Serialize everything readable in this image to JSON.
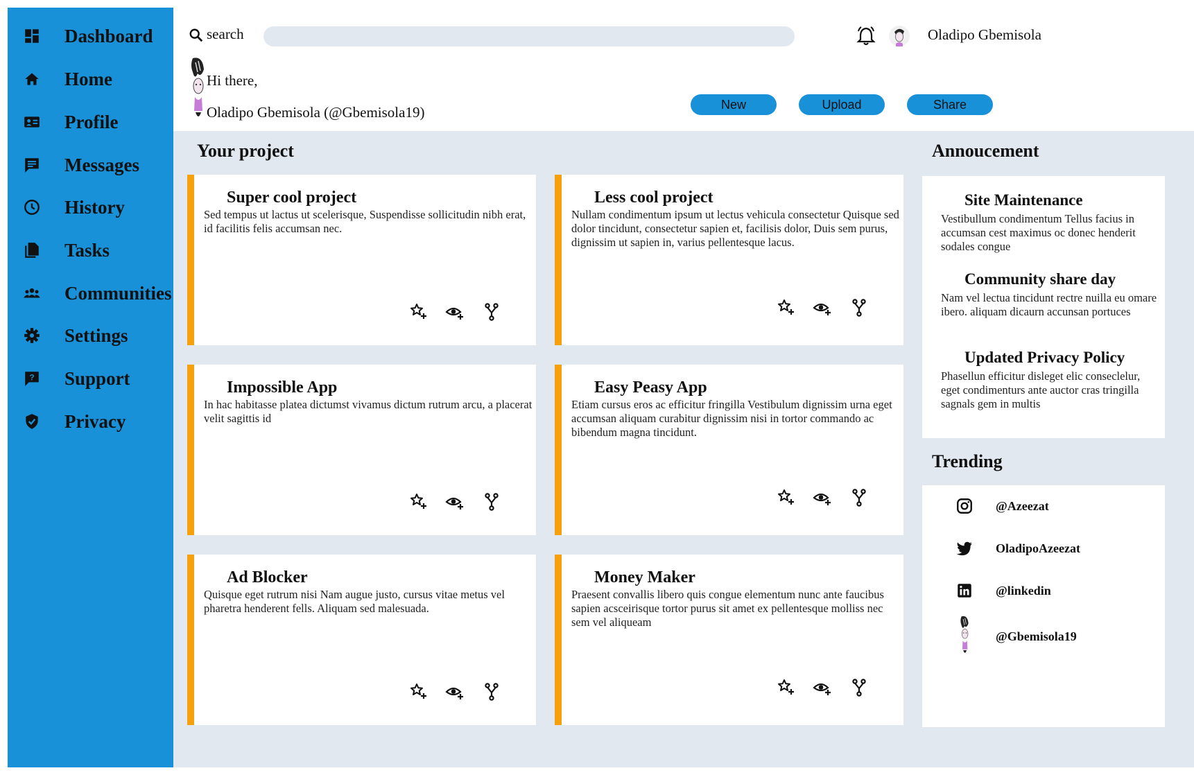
{
  "sidebar": {
    "items": [
      {
        "label": "Dashboard",
        "icon": "dashboard-icon"
      },
      {
        "label": "Home",
        "icon": "home-icon"
      },
      {
        "label": "Profile",
        "icon": "id-card-icon"
      },
      {
        "label": "Messages",
        "icon": "message-icon"
      },
      {
        "label": "History",
        "icon": "clock-icon"
      },
      {
        "label": "Tasks",
        "icon": "files-icon"
      },
      {
        "label": "Communities",
        "icon": "group-icon"
      },
      {
        "label": "Settings",
        "icon": "gear-icon"
      },
      {
        "label": "Support",
        "icon": "help-icon"
      },
      {
        "label": "Privacy",
        "icon": "shield-icon"
      }
    ]
  },
  "header": {
    "search_label": "search",
    "search_placeholder": "",
    "user_name": "Oladipo Gbemisola"
  },
  "hero": {
    "greeting": "Hi there,",
    "handle": "Oladipo Gbemisola (@Gbemisola19)",
    "buttons": {
      "new": "New",
      "upload": "Upload",
      "share": "Share"
    }
  },
  "projects": {
    "title": "Your project",
    "items": [
      {
        "title": "Super cool project",
        "desc": "Sed tempus ut lactus ut scelerisque, Suspendisse sollicitudin nibh erat, id facilitis felis accumsan nec."
      },
      {
        "title": "Less cool project",
        "desc": "Nullam condimentum ipsum ut lectus vehicula consectetur Quisque sed dolor tincidunt, consectetur sapien et, facilisis dolor, Duis sem purus, dignissim ut sapien in, varius pellentesque lacus."
      },
      {
        "title": "Impossible App",
        "desc": "In hac habitasse platea dictumst vivamus dictum rutrum arcu, a placerat velit sagittis id"
      },
      {
        "title": "Easy Peasy App",
        "desc": "Etiam cursus eros ac efficitur fringilla Vestibulum dignissim urna eget accumsan aliquam curabitur dignissim nisi in tortor commando ac bibendum magna tincidunt."
      },
      {
        "title": "Ad Blocker",
        "desc": "Quisque eget rutrum nisi Nam augue justo, cursus vitae metus vel pharetra henderent fells. Aliquam sed malesuada."
      },
      {
        "title": "Money Maker",
        "desc": "Praesent convallis libero quis congue elementum nunc ante faucibus sapien acsceirisque tortor purus sit amet ex pellentesque molliss nec sem vel aliqueam"
      }
    ]
  },
  "announcement": {
    "title": "Annoucement",
    "items": [
      {
        "title": "Site Maintenance",
        "text": "Vestibullum condimentum Tellus facius in accumsan cest maximus oc donec henderit sodales congue"
      },
      {
        "title": "Community share day",
        "text": "Nam vel lectua tincidunt rectre nuilla eu omare ibero. aliquam dicaurn accunsan portuces"
      },
      {
        "title": "Updated Privacy Policy",
        "text": "Phasellun efficitur disleget elic conseclelur, eget condimenturs ante auctor cras tringilla sagnals gem in multis"
      }
    ]
  },
  "trending": {
    "title": "Trending",
    "items": [
      {
        "label": "@Azeezat",
        "icon": "instagram-icon"
      },
      {
        "label": "OladipoAzeezat",
        "icon": "twitter-icon"
      },
      {
        "label": "@linkedin",
        "icon": "linkedin-icon"
      },
      {
        "label": "@Gbemisola19",
        "icon": "avatar-icon"
      }
    ]
  },
  "colors": {
    "sidebar": "#1991d8",
    "accent": "#f5a00c",
    "background": "#e1e8f0"
  }
}
